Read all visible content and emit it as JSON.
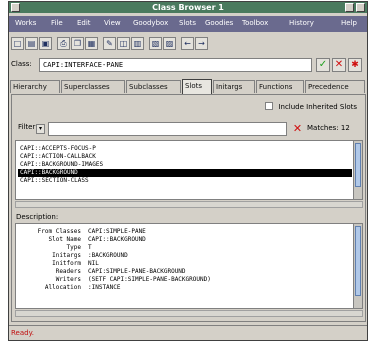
{
  "window": {
    "title": "Class Browser 1"
  },
  "menu": [
    {
      "label": "Works",
      "x": 0
    },
    {
      "label": "File",
      "x": 1
    },
    {
      "label": "Edit",
      "x": 2
    },
    {
      "label": "View",
      "x": 3
    },
    {
      "label": "Goodybox",
      "x": 4
    },
    {
      "label": "Slots",
      "x": 5
    },
    {
      "label": "Goodies",
      "x": 6
    },
    {
      "label": "Toolbox",
      "x": 7
    },
    {
      "label": "History",
      "x": 8
    },
    {
      "label": "Help",
      "x": 9
    }
  ],
  "toolbar": {
    "icons": [
      "new-icon",
      "open-icon",
      "save-icon",
      "print-icon",
      "copy-icon",
      "paste-icon",
      "inspect-icon",
      "class-icon",
      "slot-icon",
      "method-icon",
      "browse-icon",
      "back-arrow-icon",
      "forward-arrow-icon"
    ]
  },
  "class_field": {
    "label": "Class:",
    "value": "CAPI:INTERFACE-PANE"
  },
  "tabs": [
    {
      "label": "Hierarchy"
    },
    {
      "label": "Superclasses"
    },
    {
      "label": "Subclasses"
    },
    {
      "label": "Slots"
    },
    {
      "label": "Initargs"
    },
    {
      "label": "Functions"
    },
    {
      "label": "Precedence"
    }
  ],
  "active_tab": "Slots",
  "include_inherited": {
    "label": "Include Inherited Slots"
  },
  "filter": {
    "label": "Filter",
    "value": "",
    "matches_label": "Matches: 12"
  },
  "slots": [
    "CAPI::ACCEPTS-FOCUS-P",
    "CAPI::ACTION-CALLBACK",
    "CAPI::BACKGROUND-IMAGES",
    "CAPI::BACKGROUND",
    "CAPI::SECTION-CLASS"
  ],
  "selected_slot_index": 3,
  "description": {
    "label": "Description:",
    "rows": [
      {
        "key": "From Classes",
        "value": "CAPI:SIMPLE-PANE"
      },
      {
        "key": "Slot Name",
        "value": "CAPI::BACKGROUND"
      },
      {
        "key": "Type",
        "value": "T"
      },
      {
        "key": "Initargs",
        "value": ":BACKGROUND"
      },
      {
        "key": "Initform",
        "value": "NIL"
      },
      {
        "key": "Readers",
        "value": "CAPI:SIMPLE-PANE-BACKGROUND"
      },
      {
        "key": "Writers",
        "value": "(SETF CAPI:SIMPLE-PANE-BACKGROUND)"
      },
      {
        "key": "Allocation",
        "value": ":INSTANCE"
      }
    ]
  },
  "status": {
    "text": "Ready."
  }
}
